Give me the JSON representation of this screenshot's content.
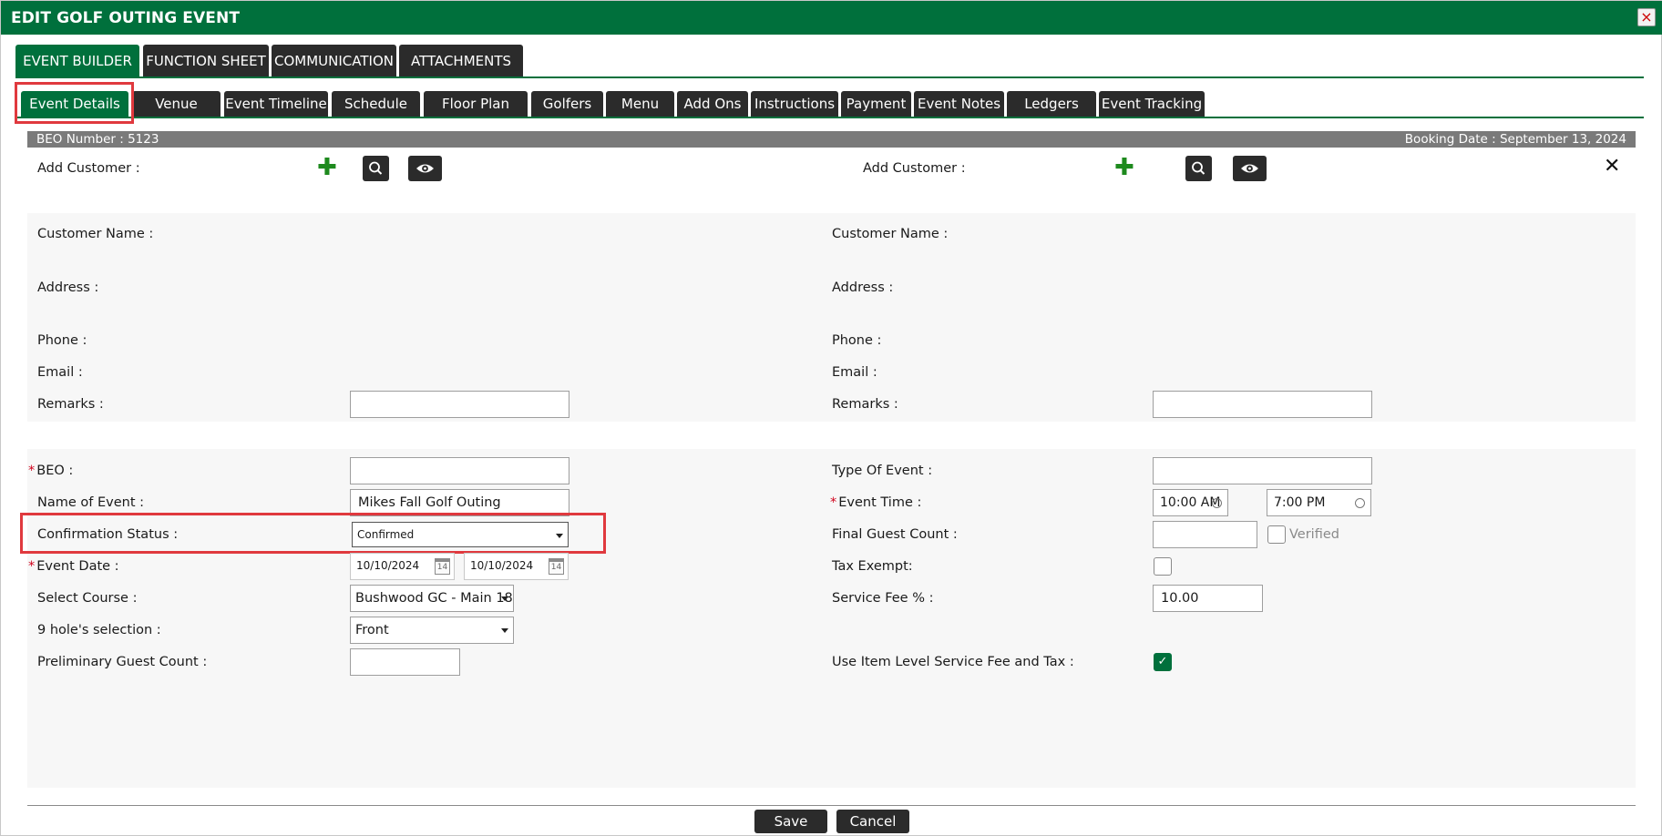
{
  "window": {
    "title": "EDIT GOLF OUTING EVENT",
    "close_glyph": "×"
  },
  "top_tabs": [
    "EVENT BUILDER",
    "FUNCTION SHEET",
    "COMMUNICATION",
    "ATTACHMENTS"
  ],
  "sub_tabs": [
    "Event Details",
    "Venue",
    "Event Timeline",
    "Schedule",
    "Floor Plan",
    "Golfers",
    "Menu",
    "Add Ons",
    "Instructions",
    "Payment",
    "Event Notes",
    "Ledgers",
    "Event Tracking"
  ],
  "beo_bar": {
    "beo_number": "BEO Number : 5123",
    "booking_date": "Booking Date : September 13, 2024"
  },
  "customer_toolbar": {
    "left_label": "Add Customer :",
    "right_label": "Add Customer :",
    "plus_glyph": "✚",
    "close_glyph": "✕"
  },
  "customer_left": {
    "name_label": "Customer Name :",
    "address_label": "Address :",
    "phone_label": "Phone :",
    "email_label": "Email :",
    "remarks_label": "Remarks :",
    "remarks_value": ""
  },
  "customer_right": {
    "name_label": "Customer Name :",
    "address_label": "Address :",
    "phone_label": "Phone :",
    "email_label": "Email :",
    "remarks_label": "Remarks  :",
    "remarks_value": ""
  },
  "event_left": {
    "required_mark": "*",
    "beo_label": "BEO :",
    "beo_value": "",
    "name_label": "Name of Event :",
    "name_value": "Mikes Fall Golf Outing",
    "confirmation_label": "Confirmation Status :",
    "confirmation_value": "Confirmed",
    "date_label": "Event Date :",
    "date_start": "10/10/2024",
    "date_end": "10/10/2024",
    "calendar_glyph": "14",
    "course_label": "Select Course :",
    "course_value": "Bushwood GC - Main 18",
    "nine_hole_label": "9 hole's selection :",
    "nine_hole_value": "Front",
    "prelim_label": "Preliminary Guest Count :",
    "prelim_value": ""
  },
  "event_right": {
    "type_label": "Type Of Event :",
    "type_value": "",
    "time_label": "Event Time :",
    "time_start": "10:00 AM",
    "time_end": "7:00 PM",
    "final_count_label": "Final Guest Count :",
    "final_count_value": "",
    "verified_label": "Verified",
    "verified_checked": false,
    "tax_exempt_label": "Tax Exempt:",
    "tax_exempt_checked": false,
    "service_fee_label": "Service Fee % :",
    "service_fee_value": "10.00",
    "item_level_label": "Use Item Level Service Fee and Tax :",
    "item_level_checked": true,
    "check_glyph": "✓"
  },
  "footer": {
    "save": "Save",
    "cancel": "Cancel"
  },
  "colors": {
    "brand_green": "#00703c",
    "dark_tab": "#2b2b2b",
    "highlight": "#e0393e",
    "beo_bar": "#7a7a7a"
  }
}
